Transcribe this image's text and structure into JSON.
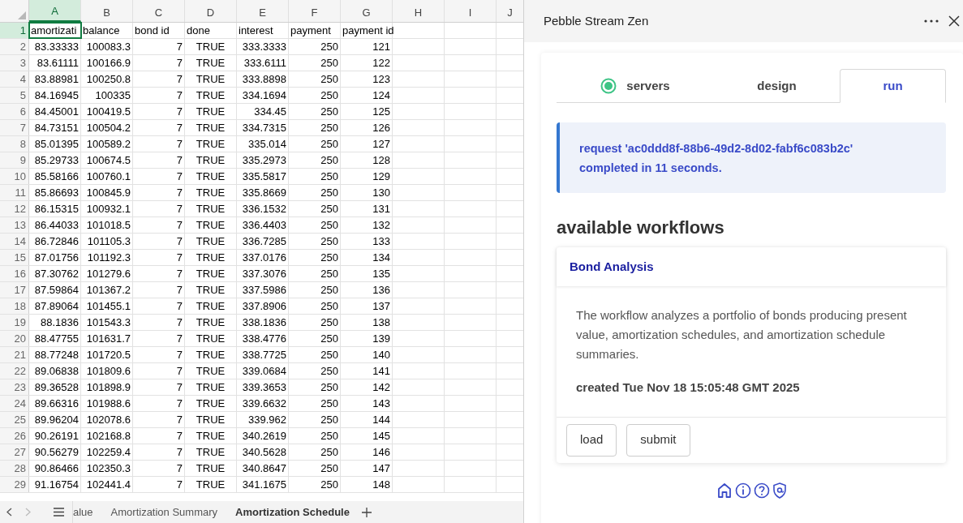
{
  "spreadsheet": {
    "columns": [
      {
        "label": "A",
        "selected": true
      },
      {
        "label": "B",
        "selected": false
      },
      {
        "label": "C",
        "selected": false
      },
      {
        "label": "D",
        "selected": false
      },
      {
        "label": "E",
        "selected": false
      },
      {
        "label": "F",
        "selected": false
      },
      {
        "label": "G",
        "selected": false
      },
      {
        "label": "H",
        "selected": false
      },
      {
        "label": "I",
        "selected": false
      },
      {
        "label": "J",
        "selected": false
      }
    ],
    "rows": [
      {
        "number": "1",
        "selected": true,
        "kind": "header",
        "cells": [
          "amortizati",
          "balance",
          "bond id",
          "done",
          "interest",
          "payment",
          "payment id"
        ]
      },
      {
        "number": "2",
        "selected": false,
        "kind": "data",
        "cells": [
          "83.33333",
          "100083.3",
          "7",
          "TRUE",
          "333.3333",
          "250",
          "121"
        ]
      },
      {
        "number": "3",
        "selected": false,
        "kind": "data",
        "cells": [
          "83.61111",
          "100166.9",
          "7",
          "TRUE",
          "333.6111",
          "250",
          "122"
        ]
      },
      {
        "number": "4",
        "selected": false,
        "kind": "data",
        "cells": [
          "83.88981",
          "100250.8",
          "7",
          "TRUE",
          "333.8898",
          "250",
          "123"
        ]
      },
      {
        "number": "5",
        "selected": false,
        "kind": "data",
        "cells": [
          "84.16945",
          "100335",
          "7",
          "TRUE",
          "334.1694",
          "250",
          "124"
        ]
      },
      {
        "number": "6",
        "selected": false,
        "kind": "data",
        "cells": [
          "84.45001",
          "100419.5",
          "7",
          "TRUE",
          "334.45",
          "250",
          "125"
        ]
      },
      {
        "number": "7",
        "selected": false,
        "kind": "data",
        "cells": [
          "84.73151",
          "100504.2",
          "7",
          "TRUE",
          "334.7315",
          "250",
          "126"
        ]
      },
      {
        "number": "8",
        "selected": false,
        "kind": "data",
        "cells": [
          "85.01395",
          "100589.2",
          "7",
          "TRUE",
          "335.014",
          "250",
          "127"
        ]
      },
      {
        "number": "9",
        "selected": false,
        "kind": "data",
        "cells": [
          "85.29733",
          "100674.5",
          "7",
          "TRUE",
          "335.2973",
          "250",
          "128"
        ]
      },
      {
        "number": "10",
        "selected": false,
        "kind": "data",
        "cells": [
          "85.58166",
          "100760.1",
          "7",
          "TRUE",
          "335.5817",
          "250",
          "129"
        ]
      },
      {
        "number": "11",
        "selected": false,
        "kind": "data",
        "cells": [
          "85.86693",
          "100845.9",
          "7",
          "TRUE",
          "335.8669",
          "250",
          "130"
        ]
      },
      {
        "number": "12",
        "selected": false,
        "kind": "data",
        "cells": [
          "86.15315",
          "100932.1",
          "7",
          "TRUE",
          "336.1532",
          "250",
          "131"
        ]
      },
      {
        "number": "13",
        "selected": false,
        "kind": "data",
        "cells": [
          "86.44033",
          "101018.5",
          "7",
          "TRUE",
          "336.4403",
          "250",
          "132"
        ]
      },
      {
        "number": "14",
        "selected": false,
        "kind": "data",
        "cells": [
          "86.72846",
          "101105.3",
          "7",
          "TRUE",
          "336.7285",
          "250",
          "133"
        ]
      },
      {
        "number": "15",
        "selected": false,
        "kind": "data",
        "cells": [
          "87.01756",
          "101192.3",
          "7",
          "TRUE",
          "337.0176",
          "250",
          "134"
        ]
      },
      {
        "number": "16",
        "selected": false,
        "kind": "data",
        "cells": [
          "87.30762",
          "101279.6",
          "7",
          "TRUE",
          "337.3076",
          "250",
          "135"
        ]
      },
      {
        "number": "17",
        "selected": false,
        "kind": "data",
        "cells": [
          "87.59864",
          "101367.2",
          "7",
          "TRUE",
          "337.5986",
          "250",
          "136"
        ]
      },
      {
        "number": "18",
        "selected": false,
        "kind": "data",
        "cells": [
          "87.89064",
          "101455.1",
          "7",
          "TRUE",
          "337.8906",
          "250",
          "137"
        ]
      },
      {
        "number": "19",
        "selected": false,
        "kind": "data",
        "cells": [
          "88.1836",
          "101543.3",
          "7",
          "TRUE",
          "338.1836",
          "250",
          "138"
        ]
      },
      {
        "number": "20",
        "selected": false,
        "kind": "data",
        "cells": [
          "88.47755",
          "101631.7",
          "7",
          "TRUE",
          "338.4776",
          "250",
          "139"
        ]
      },
      {
        "number": "21",
        "selected": false,
        "kind": "data",
        "cells": [
          "88.77248",
          "101720.5",
          "7",
          "TRUE",
          "338.7725",
          "250",
          "140"
        ]
      },
      {
        "number": "22",
        "selected": false,
        "kind": "data",
        "cells": [
          "89.06838",
          "101809.6",
          "7",
          "TRUE",
          "339.0684",
          "250",
          "141"
        ]
      },
      {
        "number": "23",
        "selected": false,
        "kind": "data",
        "cells": [
          "89.36528",
          "101898.9",
          "7",
          "TRUE",
          "339.3653",
          "250",
          "142"
        ]
      },
      {
        "number": "24",
        "selected": false,
        "kind": "data",
        "cells": [
          "89.66316",
          "101988.6",
          "7",
          "TRUE",
          "339.6632",
          "250",
          "143"
        ]
      },
      {
        "number": "25",
        "selected": false,
        "kind": "data",
        "cells": [
          "89.96204",
          "102078.6",
          "7",
          "TRUE",
          "339.962",
          "250",
          "144"
        ]
      },
      {
        "number": "26",
        "selected": false,
        "kind": "data",
        "cells": [
          "90.26191",
          "102168.8",
          "7",
          "TRUE",
          "340.2619",
          "250",
          "145"
        ]
      },
      {
        "number": "27",
        "selected": false,
        "kind": "data",
        "cells": [
          "90.56279",
          "102259.4",
          "7",
          "TRUE",
          "340.5628",
          "250",
          "146"
        ]
      },
      {
        "number": "28",
        "selected": false,
        "kind": "data",
        "cells": [
          "90.86466",
          "102350.3",
          "7",
          "TRUE",
          "340.8647",
          "250",
          "147"
        ]
      },
      {
        "number": "29",
        "selected": false,
        "kind": "data",
        "cells": [
          "91.16754",
          "102441.4",
          "7",
          "TRUE",
          "341.1675",
          "250",
          "148"
        ]
      }
    ],
    "sheet_tabs": [
      {
        "label": "alue",
        "selected": false
      },
      {
        "label": "Amortization Summary",
        "selected": false
      },
      {
        "label": "Amortization Schedule",
        "selected": true
      }
    ]
  },
  "panel": {
    "title": "Pebble Stream Zen",
    "tabs": [
      {
        "label": "servers",
        "kind": "status",
        "selected": false
      },
      {
        "label": "design",
        "kind": "plain",
        "selected": false
      },
      {
        "label": "run",
        "kind": "plain",
        "selected": true
      }
    ],
    "alert": "request 'ac0ddd8f-88b6-49d2-8d02-fabf6c083b2c' completed in 11 seconds.",
    "heading": "available workflows",
    "workflows": [
      {
        "title": "Bond Analysis",
        "description": "The workflow analyzes a portfolio of bonds producing present value, amortization schedules, and amortization schedule summaries.",
        "created": "created Tue Nov 18 15:05:48 GMT 2025",
        "buttons": [
          "load",
          "submit"
        ]
      }
    ]
  }
}
